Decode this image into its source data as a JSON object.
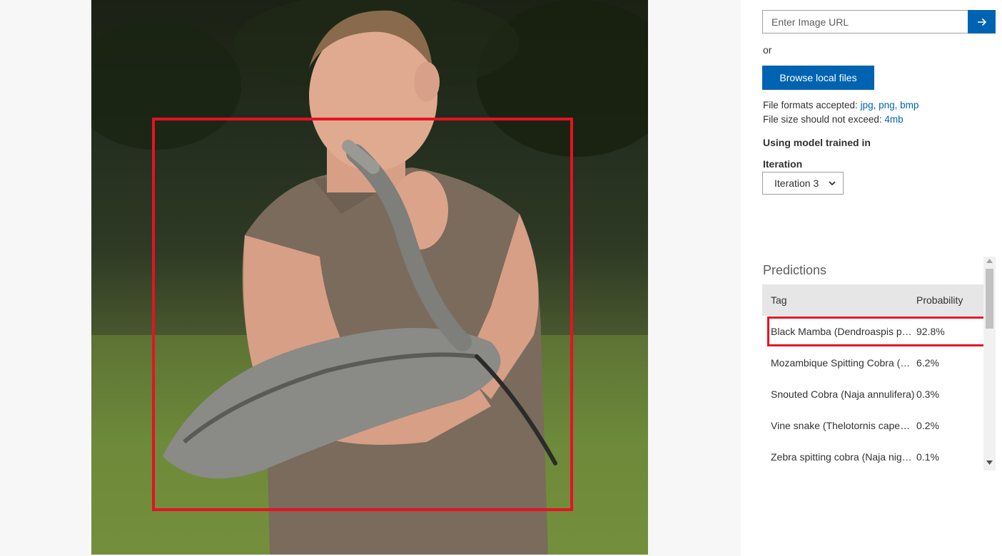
{
  "url_input": {
    "placeholder": "Enter Image URL",
    "value": ""
  },
  "or_text": "or",
  "browse_label": "Browse local files",
  "formats": {
    "label": "File formats accepted:",
    "values": "jpg, png, bmp"
  },
  "size": {
    "label": "File size should not exceed:",
    "value": "4mb"
  },
  "model_label": "Using model trained in",
  "iteration": {
    "label": "Iteration",
    "selected": "Iteration 3"
  },
  "predictions": {
    "title": "Predictions",
    "columns": {
      "tag": "Tag",
      "probability": "Probability"
    },
    "rows": [
      {
        "tag": "Black Mamba (Dendroaspis polylepis)",
        "probability": "92.8%"
      },
      {
        "tag": "Mozambique Spitting Cobra (Naja mossambica)",
        "probability": "6.2%"
      },
      {
        "tag": "Snouted Cobra (Naja annulifera)",
        "probability": "0.3%"
      },
      {
        "tag": "Vine snake (Thelotornis capensis)",
        "probability": "0.2%"
      },
      {
        "tag": "Zebra spitting cobra (Naja nigricincta)",
        "probability": "0.1%"
      }
    ]
  },
  "colors": {
    "accent": "#0063b1",
    "highlight": "#e81123"
  },
  "icons": {
    "go": "arrow-right-icon",
    "select": "chevron-down-icon"
  }
}
